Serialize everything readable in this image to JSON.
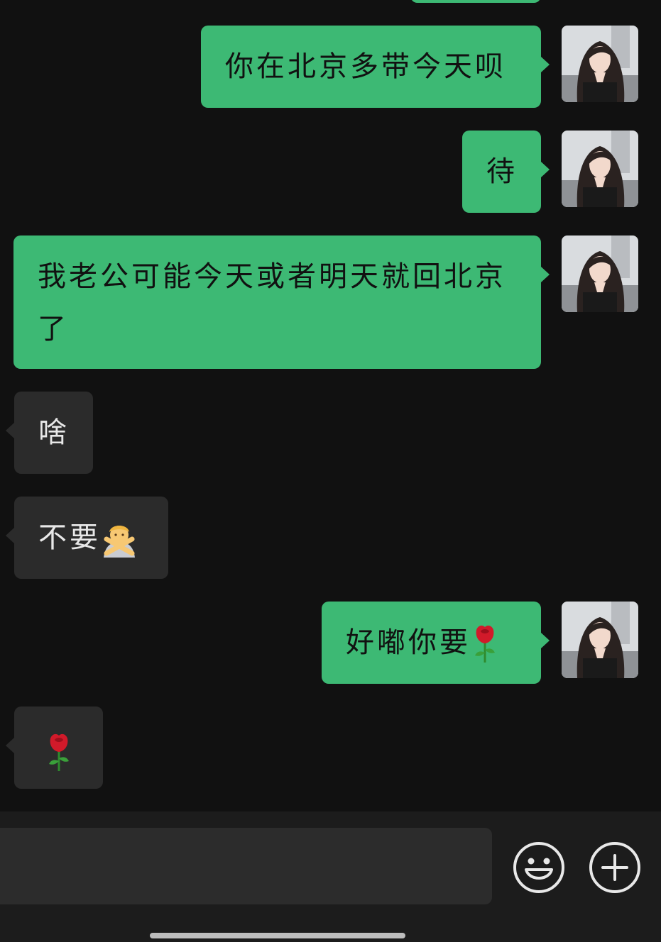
{
  "messages": [
    {
      "side": "mine",
      "text": "你在北京多带今天呗"
    },
    {
      "side": "mine",
      "text": "待"
    },
    {
      "side": "mine",
      "text": "我老公可能今天或者明天就回北京了"
    },
    {
      "side": "theirs",
      "text": "啥"
    },
    {
      "side": "theirs",
      "text": "不要",
      "emoji": "person-gesturing-no-icon"
    },
    {
      "side": "mine",
      "text": "好嘟你要",
      "emoji": "rose-icon"
    },
    {
      "side": "theirs",
      "text": "",
      "emoji": "rose-icon"
    }
  ],
  "input": {
    "placeholder": "",
    "value": ""
  },
  "icons": {
    "emoji_button": "smiley-face-icon",
    "plus_button": "plus-circle-icon"
  },
  "colors": {
    "background": "#111111",
    "bubble_mine": "#3db974",
    "bubble_theirs": "#2b2b2b",
    "input_bar": "#1c1c1c"
  }
}
